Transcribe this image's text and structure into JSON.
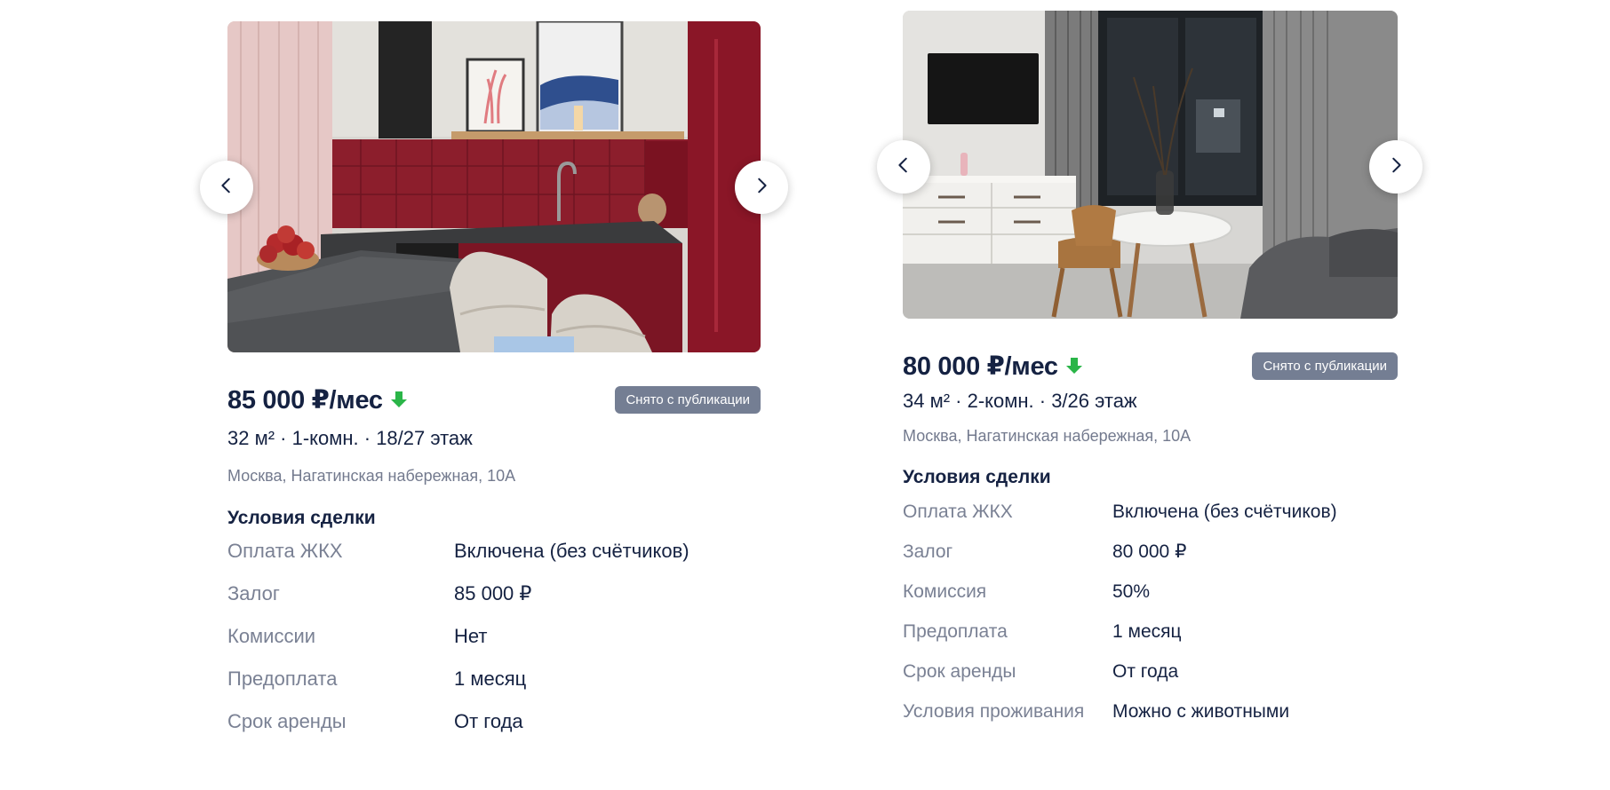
{
  "listings": [
    {
      "price": "85 000 ₽/мес",
      "status": "Снято с публикации",
      "params": "32 м² · 1-комн. · 18/27 этаж",
      "address": "Москва, Нагатинская набережная, 10А",
      "terms_title": "Условия сделки",
      "terms": [
        {
          "label": "Оплата ЖКХ",
          "value": "Включена (без счётчиков)"
        },
        {
          "label": "Залог",
          "value": "85 000 ₽"
        },
        {
          "label": "Комиссии",
          "value": "Нет"
        },
        {
          "label": "Предоплата",
          "value": "1 месяц"
        },
        {
          "label": "Срок аренды",
          "value": "От года"
        }
      ]
    },
    {
      "price": "80 000 ₽/мес",
      "status": "Снято с публикации",
      "params": "34 м² · 2-комн. · 3/26 этаж",
      "address": "Москва, Нагатинская набережная, 10А",
      "terms_title": "Условия сделки",
      "terms": [
        {
          "label": "Оплата ЖКХ",
          "value": "Включена (без счётчиков)"
        },
        {
          "label": "Залог",
          "value": "80 000 ₽"
        },
        {
          "label": "Комиссия",
          "value": "50%"
        },
        {
          "label": "Предоплата",
          "value": "1 месяц"
        },
        {
          "label": "Срок аренды",
          "value": "От года"
        },
        {
          "label": "Условия проживания",
          "value": "Можно с животными"
        }
      ]
    }
  ],
  "icons": {
    "price_trend": "arrow-down-icon",
    "gallery_prev": "chevron-left-icon",
    "gallery_next": "chevron-right-icon"
  },
  "colors": {
    "text_primary": "#152242",
    "text_secondary": "#737a8e",
    "badge_bg": "#747e93",
    "price_down": "#2ab548"
  }
}
